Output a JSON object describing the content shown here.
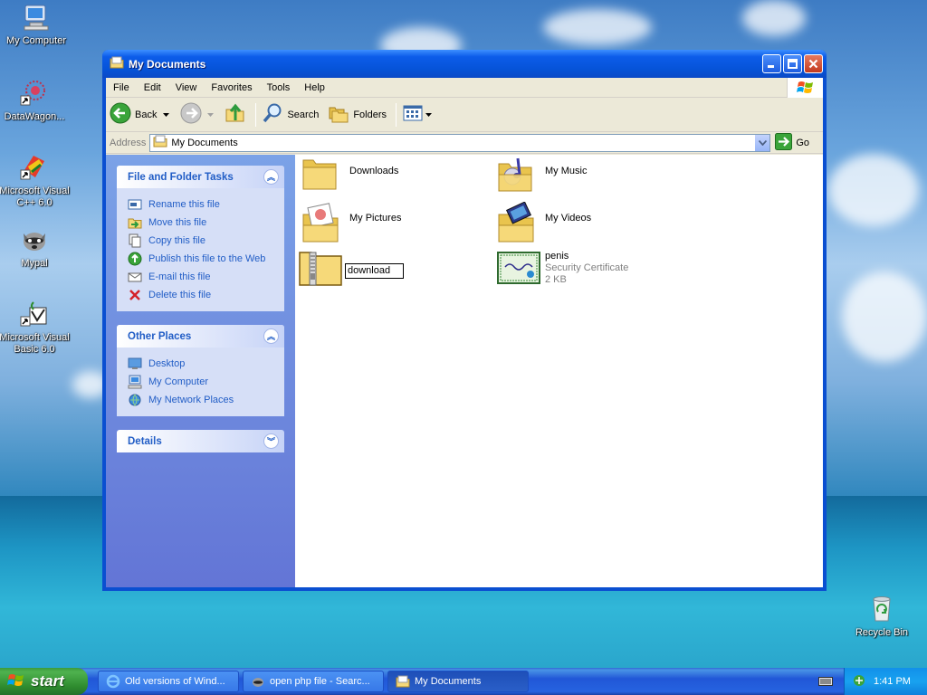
{
  "desktop": {
    "icons": [
      {
        "label": "My Computer"
      },
      {
        "label": "DataWagon..."
      },
      {
        "label": "Microsoft Visual C++ 6.0"
      },
      {
        "label": "Mypal"
      },
      {
        "label": "Microsoft Visual Basic 6.0"
      },
      {
        "label": "Recycle Bin"
      }
    ]
  },
  "window": {
    "title": "My Documents",
    "menu": [
      "File",
      "Edit",
      "View",
      "Favorites",
      "Tools",
      "Help"
    ],
    "toolbar": {
      "back": "Back",
      "search": "Search",
      "folders": "Folders"
    },
    "address": {
      "label": "Address",
      "value": "My Documents",
      "go": "Go"
    }
  },
  "left_pane": {
    "file_tasks": {
      "title": "File and Folder Tasks",
      "items": [
        {
          "label": "Rename this file",
          "icon": "rename-icon"
        },
        {
          "label": "Move this file",
          "icon": "move-icon"
        },
        {
          "label": "Copy this file",
          "icon": "copy-icon"
        },
        {
          "label": "Publish this file to the Web",
          "icon": "publish-web-icon"
        },
        {
          "label": "E-mail this file",
          "icon": "email-icon"
        },
        {
          "label": "Delete this file",
          "icon": "delete-icon"
        }
      ]
    },
    "other_places": {
      "title": "Other Places",
      "items": [
        {
          "label": "Desktop",
          "icon": "desktop-icon"
        },
        {
          "label": "My Computer",
          "icon": "my-computer-icon"
        },
        {
          "label": "My Network Places",
          "icon": "network-places-icon"
        }
      ]
    },
    "details": {
      "title": "Details"
    }
  },
  "content": {
    "items": [
      {
        "name": "Downloads",
        "type": "folder"
      },
      {
        "name": "My Music",
        "type": "music-folder"
      },
      {
        "name": "My Pictures",
        "type": "pictures-folder"
      },
      {
        "name": "My Videos",
        "type": "videos-folder"
      },
      {
        "name": "download",
        "type": "zip-folder",
        "renaming": true
      },
      {
        "name": "penis",
        "type": "certificate",
        "subtitle": "Security Certificate",
        "size": "2 KB"
      }
    ]
  },
  "taskbar": {
    "start": "start",
    "tasks": [
      {
        "label": "Old versions of Wind..."
      },
      {
        "label": "open php file - Searc..."
      },
      {
        "label": "My Documents",
        "active": true
      }
    ],
    "clock": "1:41 PM"
  },
  "colors": {
    "accent": "#0a4fd1",
    "link": "#215dc6",
    "taskpane": "#6375d6"
  }
}
